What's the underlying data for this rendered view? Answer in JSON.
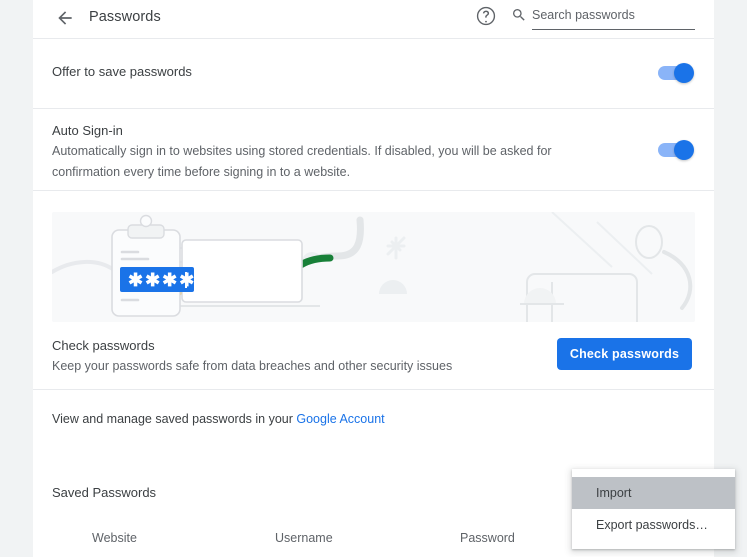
{
  "header": {
    "back_icon": "back-arrow-icon",
    "title": "Passwords",
    "help_icon": "help-circle-icon",
    "search_icon": "search-icon",
    "search_placeholder": "Search passwords",
    "search_value": ""
  },
  "settings": {
    "offer_to_save": {
      "label": "Offer to save passwords",
      "toggle_state": "on"
    },
    "auto_signin": {
      "label": "Auto Sign-in",
      "description": "Automatically sign in to websites using stored credentials. If disabled, you will be asked for confirmation every time before signing in to a website.",
      "toggle_state": "on"
    }
  },
  "banner": {
    "name": "password-safety-illustration",
    "password_field_text": "✱✱✱✱"
  },
  "check_passwords": {
    "title": "Check passwords",
    "subtitle": "Keep your passwords safe from data breaches and other security issues",
    "button_label": "Check passwords"
  },
  "account_row": {
    "text_before_link": "View and manage saved passwords in your ",
    "link_label": "Google Account"
  },
  "saved_passwords": {
    "title": "Saved Passwords",
    "columns": [
      "Website",
      "Username",
      "Password"
    ],
    "rows": []
  },
  "context_menu": {
    "items": [
      {
        "label": "Import",
        "highlighted": true
      },
      {
        "label": "Export passwords…",
        "highlighted": false
      }
    ]
  },
  "colors": {
    "accent_blue": "#1a73e8",
    "toggle_track": "#8ab4f8",
    "link_blue": "#1a73e8",
    "text_primary": "#3c4043",
    "text_secondary": "#5f6368",
    "divider": "#e8eaed",
    "banner_bg": "#f8f9fa",
    "page_bg": "#f1f3f4",
    "menu_highlight": "#bdc1c6"
  }
}
